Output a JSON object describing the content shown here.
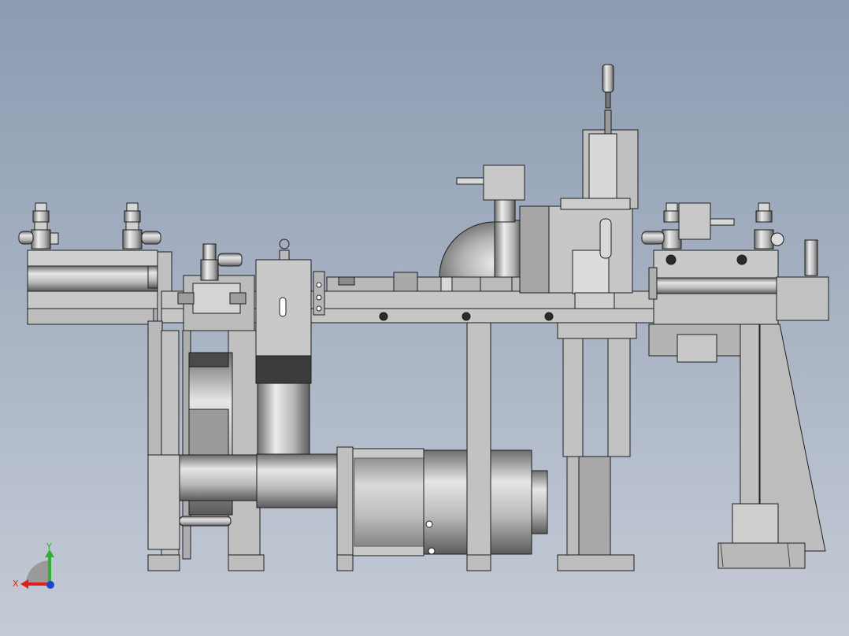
{
  "viewport": {
    "background_top": "#8b9bb1",
    "background_bottom": "#c5cbd6"
  },
  "colors": {
    "metal": "#c4c4c4",
    "metal_light": "#dcdcdc",
    "metal_dark": "#8a8a8a",
    "outline": "#1e1e1e",
    "band": "#3c3c3c",
    "axis_x": "#e0201c",
    "axis_y": "#2fb12f",
    "axis_z": "#2244cc",
    "triad_fan": "#9a9a9a"
  },
  "triad": {
    "x_label": "X",
    "y_label": "Y",
    "x_icon": "x-axis-arrow-icon",
    "y_icon": "y-axis-arrow-icon",
    "z_icon": "z-axis-dot-icon"
  }
}
